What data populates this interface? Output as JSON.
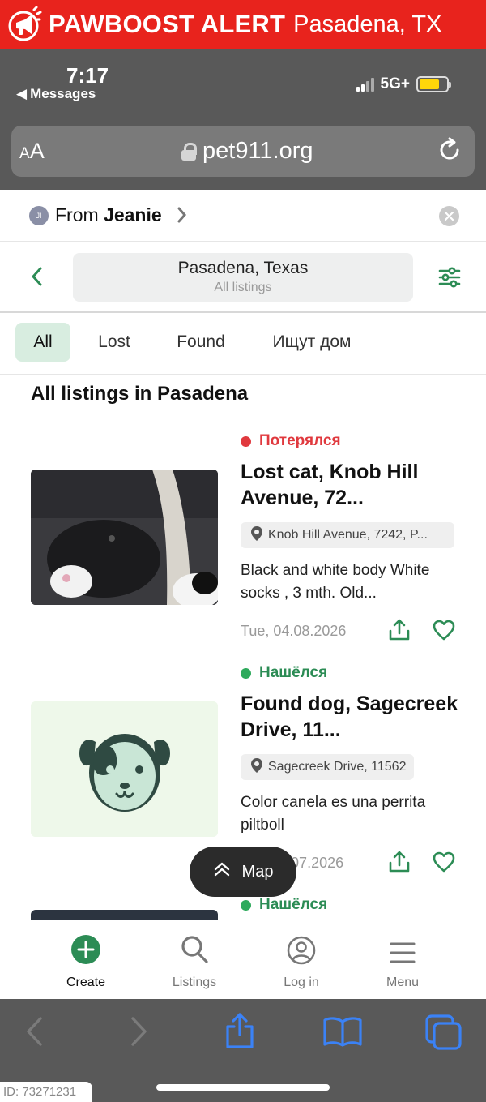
{
  "banner": {
    "brand": "PAWBOOST ALERT",
    "location": "Pasadena, TX"
  },
  "status_bar": {
    "time": "7:17",
    "back_app": "Messages",
    "network": "5G+",
    "battery_level": 0.75
  },
  "browser": {
    "text_size": "AA",
    "url": "pet911.org"
  },
  "shared_from": {
    "initials": "JI",
    "prefix": "From",
    "name": "Jeanie"
  },
  "search": {
    "location": "Pasadena, Texas",
    "subtitle": "All listings"
  },
  "tabs": [
    {
      "label": "All",
      "active": true
    },
    {
      "label": "Lost",
      "active": false
    },
    {
      "label": "Found",
      "active": false
    },
    {
      "label": "Ищут дом",
      "active": false
    }
  ],
  "section_title": "All listings in Pasadena",
  "listings": [
    {
      "status": "Потерялся",
      "status_color": "#e0393e",
      "title": "Lost cat, Knob Hill Avenue, 72...",
      "address": "Knob Hill Avenue, 7242, P...",
      "description": "Black and white body White socks , 3 mth. Old...",
      "date": "Tue, 04.08.2026"
    },
    {
      "status": "Нашёлся",
      "status_color": "#2eaa5c",
      "title": "Found dog, Sagecreek Drive, 11...",
      "address": "Sagecreek Drive, 11562",
      "description": "Color canela es una perrita piltboll",
      "date": "Sat, 25.07.2026"
    },
    {
      "status": "Нашёлся",
      "status_color": "#2eaa5c"
    }
  ],
  "map_button": "Map",
  "bottom_nav": [
    {
      "label": "Create",
      "icon": "plus-circle-icon"
    },
    {
      "label": "Listings",
      "icon": "search-icon"
    },
    {
      "label": "Log in",
      "icon": "user-icon"
    },
    {
      "label": "Menu",
      "icon": "hamburger-icon"
    }
  ],
  "id_tag": "ID: 73271231",
  "colors": {
    "accent": "#2c8c55",
    "banner": "#e8231d",
    "safari_blue": "#3b82f6"
  }
}
